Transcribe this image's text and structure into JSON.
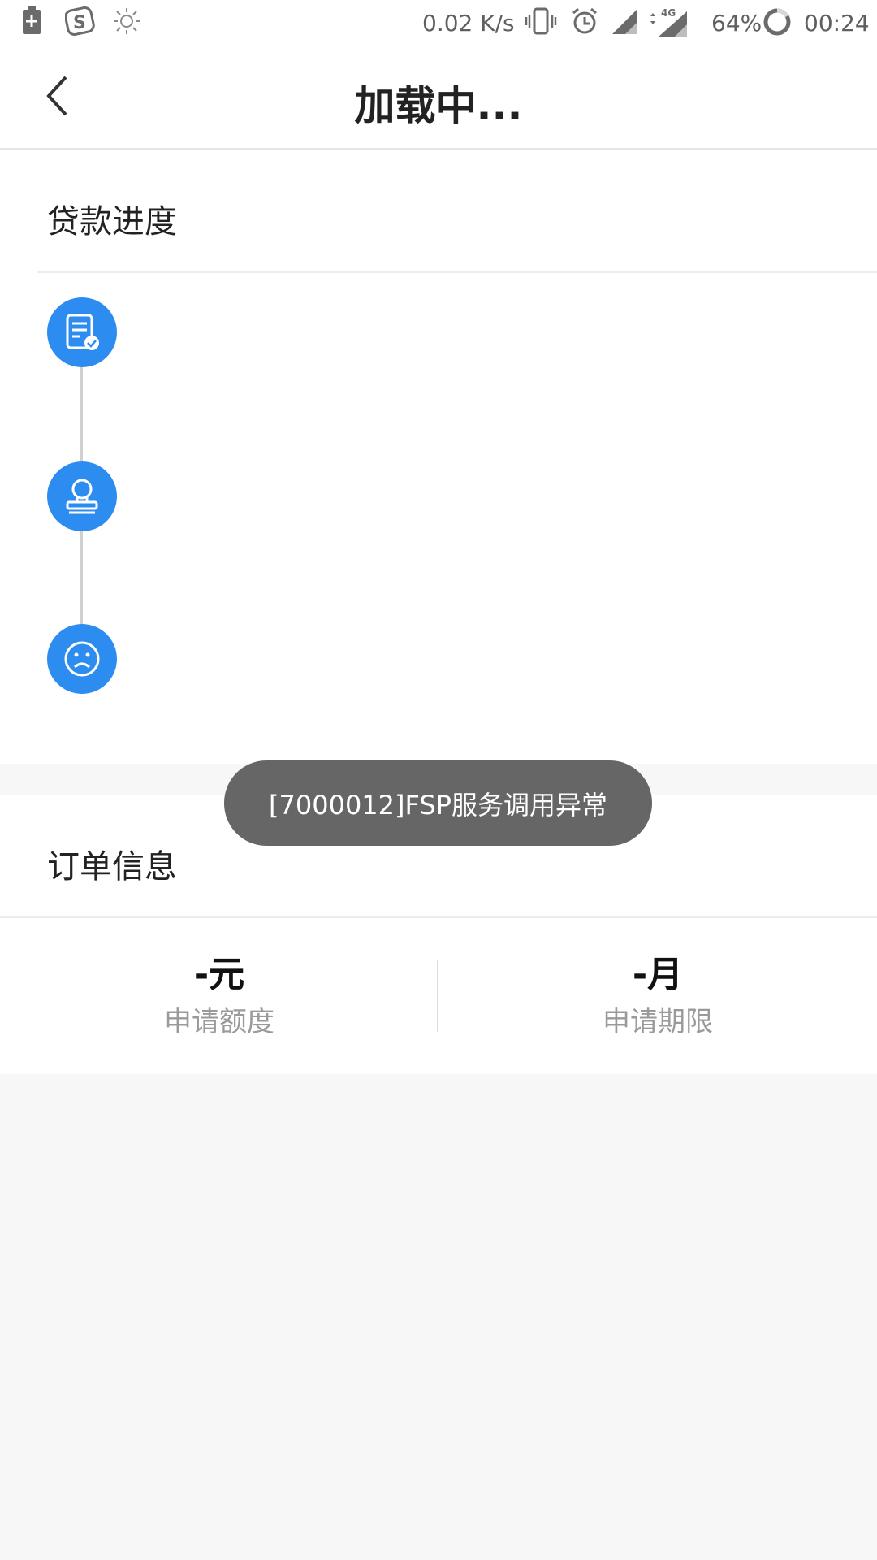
{
  "status_bar": {
    "speed": "0.02 K/s",
    "battery_percent": "64%",
    "time": "00:24",
    "network": "4G"
  },
  "header": {
    "title": "加载中..."
  },
  "loan_progress": {
    "title": "贷款进度",
    "steps": [
      {
        "icon": "document-check-icon"
      },
      {
        "icon": "stamp-icon"
      },
      {
        "icon": "sad-face-icon"
      }
    ]
  },
  "toast": {
    "message": "[7000012]FSP服务调用异常"
  },
  "order_info": {
    "title": "订单信息",
    "amount_value": "-元",
    "amount_label": "申请额度",
    "term_value": "-月",
    "term_label": "申请期限"
  },
  "colors": {
    "accent": "#2d8cf0",
    "toast_bg": "#666666"
  }
}
